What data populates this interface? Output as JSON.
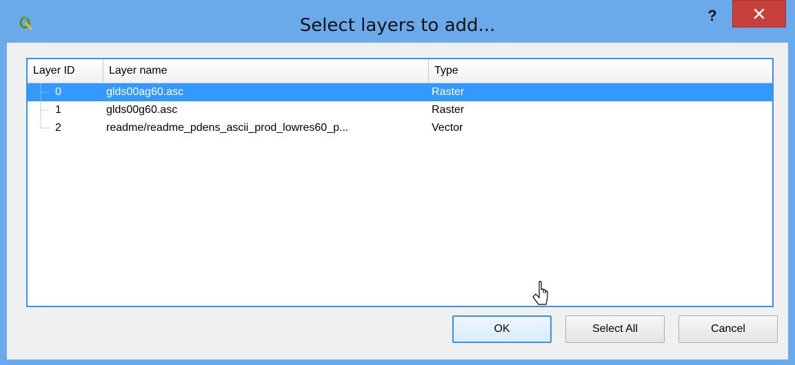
{
  "window": {
    "title": "Select layers to add..."
  },
  "titlebar": {
    "help_label": "?"
  },
  "table": {
    "columns": [
      "Layer ID",
      "Layer name",
      "Type"
    ],
    "rows": [
      {
        "id": "0",
        "name": "glds00ag60.asc",
        "type": "Raster",
        "selected": true
      },
      {
        "id": "1",
        "name": "glds00g60.asc",
        "type": "Raster",
        "selected": false
      },
      {
        "id": "2",
        "name": "readme/readme_pdens_ascii_prod_lowres60_p...",
        "type": "Vector",
        "selected": false
      }
    ]
  },
  "buttons": {
    "ok": "OK",
    "select_all": "Select All",
    "cancel": "Cancel"
  },
  "colors": {
    "titlebar": "#6aa9ea",
    "close": "#c7413a",
    "selection": "#3399ff",
    "focus_border": "#3c8ee0"
  },
  "icons": {
    "app": "qgis-icon",
    "close": "close-icon",
    "pointer": "mouse-pointer-icon"
  }
}
